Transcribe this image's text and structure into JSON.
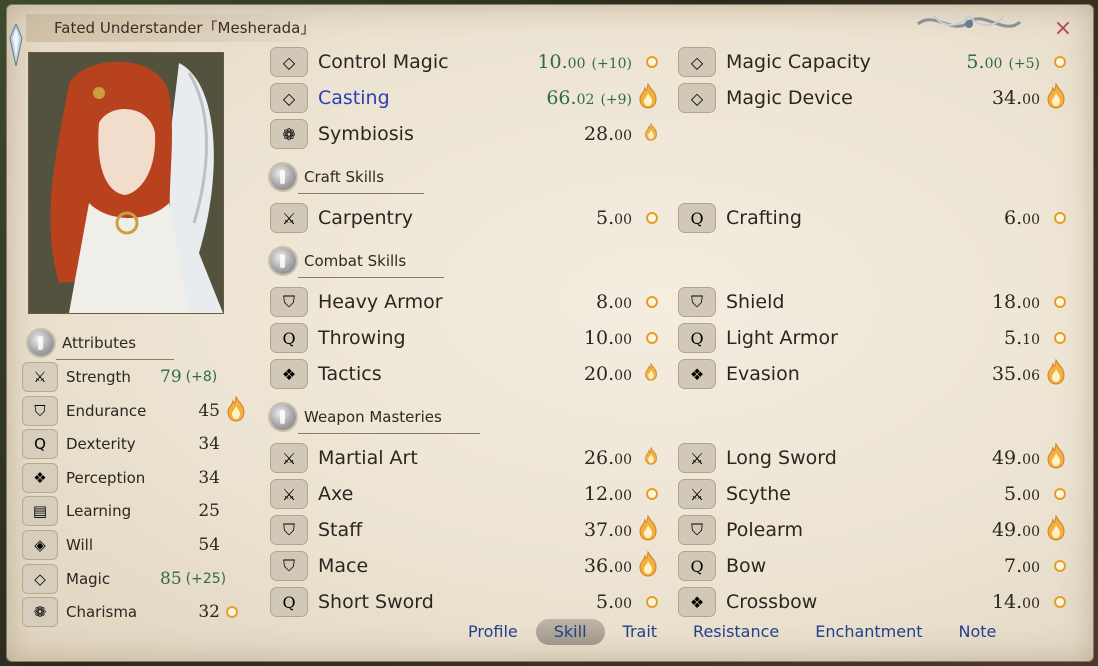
{
  "window": {
    "title": "Fated Understander「Mesherada」",
    "close_label": "×"
  },
  "attributes": {
    "heading": "Attributes",
    "items": [
      {
        "icon": "crossed-swords-icon",
        "glyph": "⚔",
        "name": "Strength",
        "value": "79",
        "bonus": "(+8)",
        "mark": "",
        "highlight": true
      },
      {
        "icon": "helmet-icon",
        "glyph": "⛉",
        "name": "Endurance",
        "value": "45",
        "bonus": "",
        "mark": "flame",
        "highlight": false
      },
      {
        "icon": "q-icon",
        "glyph": "Q",
        "name": "Dexterity",
        "value": "34",
        "bonus": "",
        "mark": "",
        "highlight": false
      },
      {
        "icon": "perception-icon",
        "glyph": "❖",
        "name": "Perception",
        "value": "34",
        "bonus": "",
        "mark": "",
        "highlight": false
      },
      {
        "icon": "book-icon",
        "glyph": "▤",
        "name": "Learning",
        "value": "25",
        "bonus": "",
        "mark": "",
        "highlight": false
      },
      {
        "icon": "shield-icon",
        "glyph": "◈",
        "name": "Will",
        "value": "54",
        "bonus": "",
        "mark": "",
        "highlight": false
      },
      {
        "icon": "magic-icon",
        "glyph": "◇",
        "name": "Magic",
        "value": "85",
        "bonus": "(+25)",
        "mark": "",
        "highlight": true
      },
      {
        "icon": "bow-ribbon-icon",
        "glyph": "❁",
        "name": "Charisma",
        "value": "32",
        "bonus": "",
        "mark": "dot",
        "highlight": false
      }
    ]
  },
  "sections": {
    "craft": "Craft Skills",
    "combat": "Combat Skills",
    "weapon": "Weapon Masteries"
  },
  "skills": {
    "top": [
      {
        "icon": "magic-icon",
        "glyph": "◇",
        "name": "Control Magic",
        "value": "10.",
        "dec": "00",
        "bonus": "(+10)",
        "mark": "dot",
        "green": true
      },
      {
        "icon": "magic-icon",
        "glyph": "◇",
        "name": "Magic Capacity",
        "value": "5.",
        "dec": "00",
        "bonus": "(+5)",
        "mark": "dot",
        "green": true
      },
      {
        "icon": "magic-icon",
        "glyph": "◇",
        "name": "Casting",
        "value": "66.",
        "dec": "02",
        "bonus": "(+9)",
        "mark": "flame",
        "green": true,
        "blue": true
      },
      {
        "icon": "magic-icon",
        "glyph": "◇",
        "name": "Magic Device",
        "value": "34.",
        "dec": "00",
        "bonus": "",
        "mark": "flame",
        "green": false
      },
      {
        "icon": "bow-ribbon-icon",
        "glyph": "❁",
        "name": "Symbiosis",
        "value": "28.",
        "dec": "00",
        "bonus": "",
        "mark": "flame-small",
        "green": false
      }
    ],
    "craft": [
      {
        "icon": "crossed-swords-icon",
        "glyph": "⚔",
        "name": "Carpentry",
        "value": "5.",
        "dec": "00",
        "mark": "dot"
      },
      {
        "icon": "q-icon",
        "glyph": "Q",
        "name": "Crafting",
        "value": "6.",
        "dec": "00",
        "mark": "dot"
      }
    ],
    "combat": [
      {
        "icon": "helmet-icon",
        "glyph": "⛉",
        "name": "Heavy Armor",
        "value": "8.",
        "dec": "00",
        "mark": "dot"
      },
      {
        "icon": "helmet-icon",
        "glyph": "⛉",
        "name": "Shield",
        "value": "18.",
        "dec": "00",
        "mark": "dot"
      },
      {
        "icon": "q-icon",
        "glyph": "Q",
        "name": "Throwing",
        "value": "10.",
        "dec": "00",
        "mark": "dot"
      },
      {
        "icon": "q-icon",
        "glyph": "Q",
        "name": "Light Armor",
        "value": "5.",
        "dec": "10",
        "mark": "dot"
      },
      {
        "icon": "perception-icon",
        "glyph": "❖",
        "name": "Tactics",
        "value": "20.",
        "dec": "00",
        "mark": "flame-small"
      },
      {
        "icon": "perception-icon",
        "glyph": "❖",
        "name": "Evasion",
        "value": "35.",
        "dec": "06",
        "mark": "flame"
      }
    ],
    "weapon": [
      {
        "icon": "crossed-swords-icon",
        "glyph": "⚔",
        "name": "Martial Art",
        "value": "26.",
        "dec": "00",
        "mark": "flame-small"
      },
      {
        "icon": "crossed-swords-icon",
        "glyph": "⚔",
        "name": "Long Sword",
        "value": "49.",
        "dec": "00",
        "mark": "flame"
      },
      {
        "icon": "crossed-swords-icon",
        "glyph": "⚔",
        "name": "Axe",
        "value": "12.",
        "dec": "00",
        "mark": "dot"
      },
      {
        "icon": "crossed-swords-icon",
        "glyph": "⚔",
        "name": "Scythe",
        "value": "5.",
        "dec": "00",
        "mark": "dot"
      },
      {
        "icon": "helmet-icon",
        "glyph": "⛉",
        "name": "Staff",
        "value": "37.",
        "dec": "00",
        "mark": "flame"
      },
      {
        "icon": "helmet-icon",
        "glyph": "⛉",
        "name": "Polearm",
        "value": "49.",
        "dec": "00",
        "mark": "flame"
      },
      {
        "icon": "helmet-icon",
        "glyph": "⛉",
        "name": "Mace",
        "value": "36.",
        "dec": "00",
        "mark": "flame"
      },
      {
        "icon": "q-icon",
        "glyph": "Q",
        "name": "Bow",
        "value": "7.",
        "dec": "00",
        "mark": "dot"
      },
      {
        "icon": "q-icon",
        "glyph": "Q",
        "name": "Short Sword",
        "value": "5.",
        "dec": "00",
        "mark": "dot"
      },
      {
        "icon": "perception-icon",
        "glyph": "❖",
        "name": "Crossbow",
        "value": "14.",
        "dec": "00",
        "mark": "dot"
      }
    ]
  },
  "tabs": [
    {
      "label": "Profile",
      "active": false
    },
    {
      "label": "Skill",
      "active": true
    },
    {
      "label": "Trait",
      "active": false
    },
    {
      "label": "Resistance",
      "active": false
    },
    {
      "label": "Enchantment",
      "active": false
    },
    {
      "label": "Note",
      "active": false
    }
  ],
  "colors": {
    "green": "#2f6a4a",
    "blue": "#2a3fb8",
    "tab_text": "#22408c",
    "flame": "#f0a030"
  }
}
